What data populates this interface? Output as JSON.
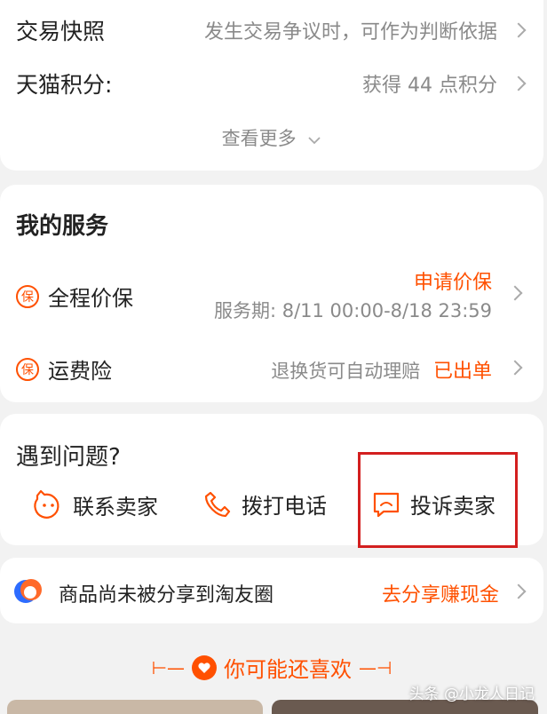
{
  "order_info": {
    "snapshot": {
      "label": "交易快照",
      "value": "发生交易争议时，可作为判断依据"
    },
    "points": {
      "label": "天猫积分:",
      "value": "获得 44 点积分"
    },
    "more": "查看更多"
  },
  "services": {
    "title": "我的服务",
    "items": [
      {
        "icon_text": "保",
        "label": "全程价保",
        "action": "申请价保",
        "detail": "服务期: 8/11 00:00-8/18 23:59"
      },
      {
        "icon_text": "保",
        "label": "运费险",
        "detail": "退换货可自动理赔",
        "status": "已出单"
      }
    ]
  },
  "problems": {
    "title": "遇到问题?",
    "actions": [
      {
        "label": "联系卖家",
        "icon": "smile-chat-icon"
      },
      {
        "label": "拨打电话",
        "icon": "phone-icon"
      },
      {
        "label": "投诉卖家",
        "icon": "complaint-icon"
      }
    ]
  },
  "share": {
    "text": "商品尚未被分享到淘友圈",
    "action": "去分享赚现金"
  },
  "recommend": {
    "title": "你可能还喜欢"
  },
  "watermark": "头条 @小龙人日记",
  "colors": {
    "accent": "#ff5000",
    "highlight": "#d31f1f",
    "background": "#f2f2f2"
  }
}
